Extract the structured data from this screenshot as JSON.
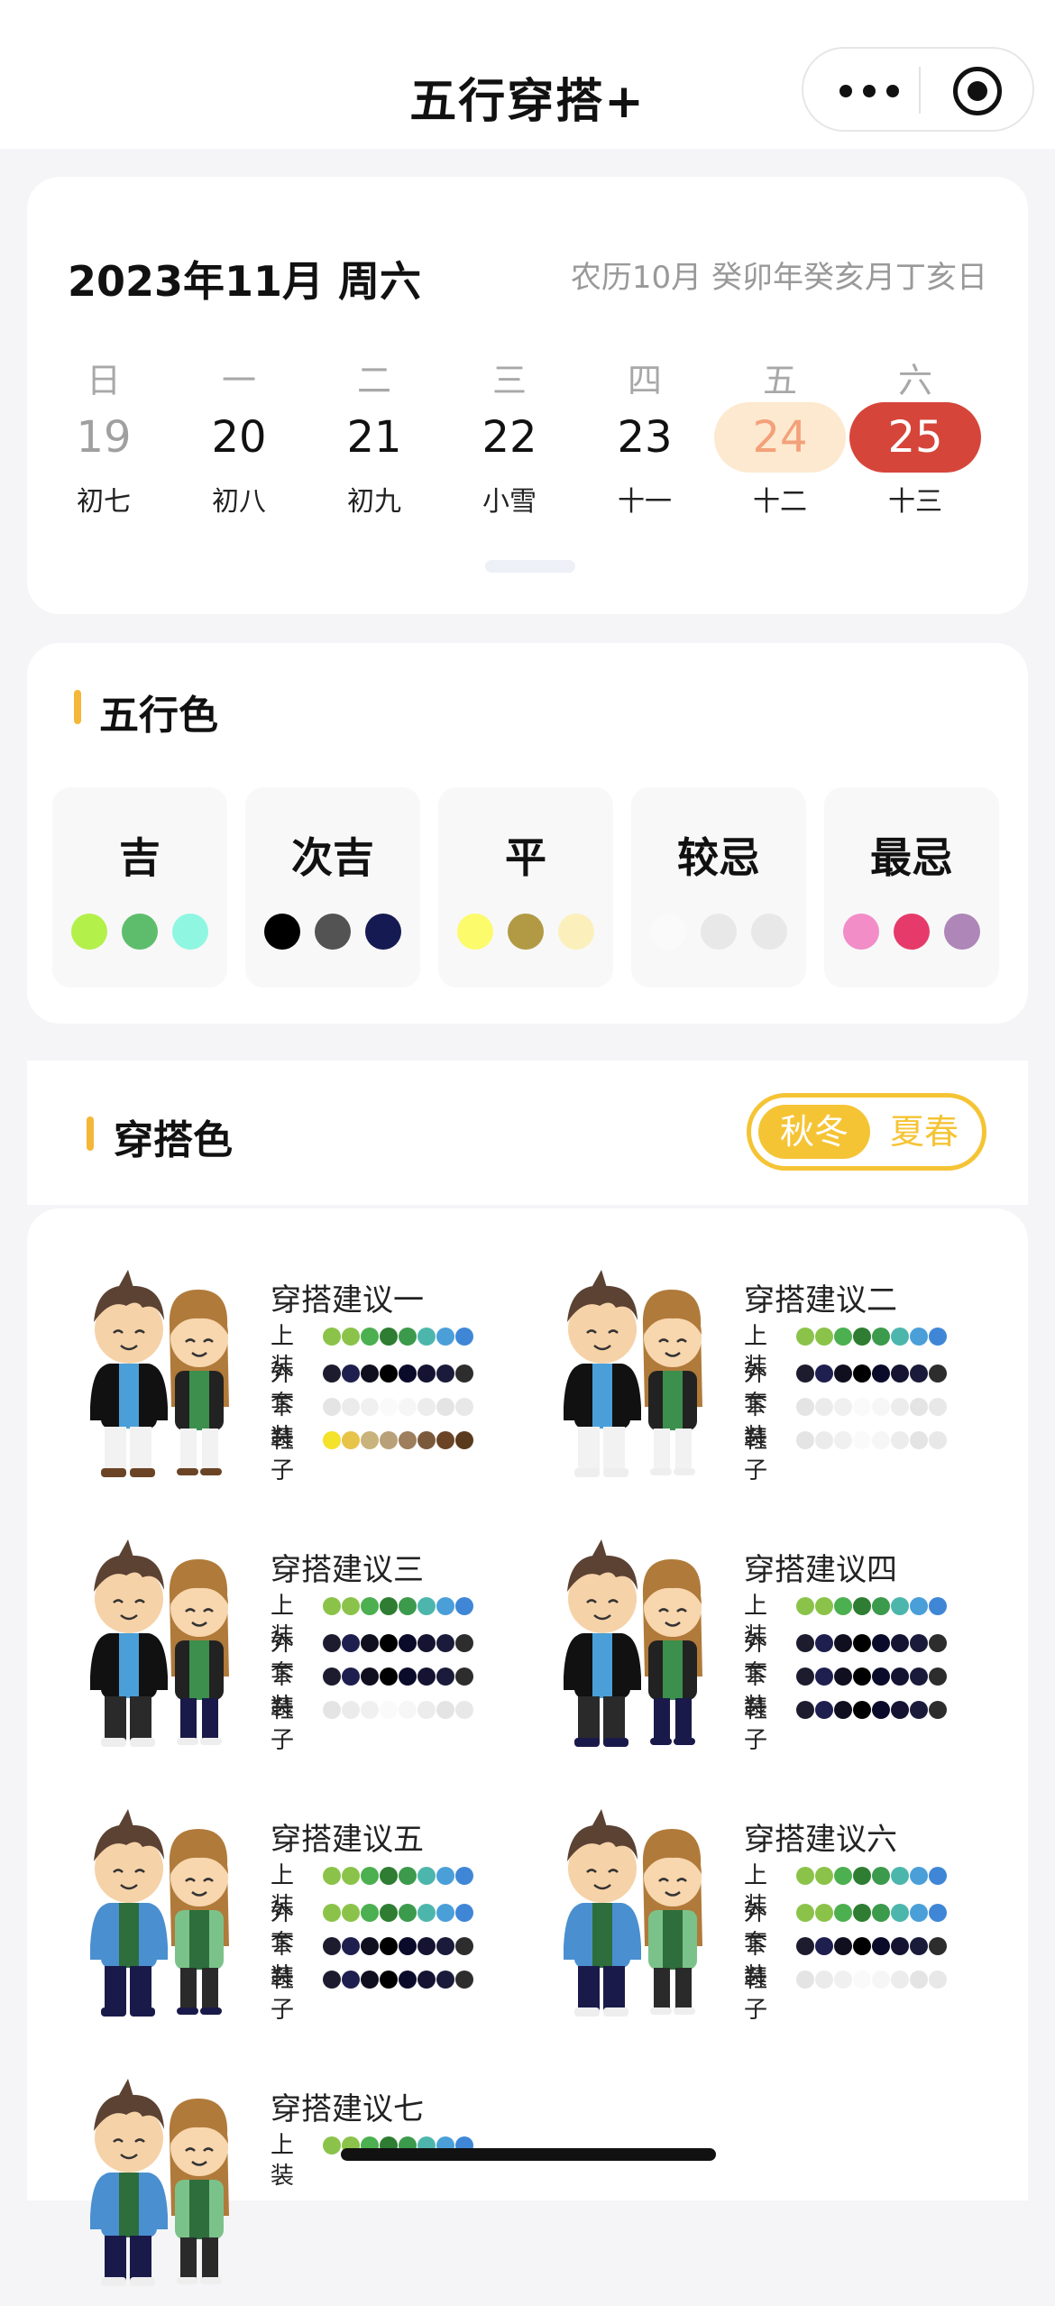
{
  "nav": {
    "title": "五行穿搭+"
  },
  "calendar": {
    "date_title": "2023年11月 周六",
    "lunar_info": "农历10月 癸卯年癸亥月丁亥日",
    "days": [
      {
        "weekday": "日",
        "date": "19",
        "lunar": "初七",
        "state": "past"
      },
      {
        "weekday": "一",
        "date": "20",
        "lunar": "初八",
        "state": "normal"
      },
      {
        "weekday": "二",
        "date": "21",
        "lunar": "初九",
        "state": "normal"
      },
      {
        "weekday": "三",
        "date": "22",
        "lunar": "小雪",
        "state": "normal"
      },
      {
        "weekday": "四",
        "date": "23",
        "lunar": "十一",
        "state": "normal"
      },
      {
        "weekday": "五",
        "date": "24",
        "lunar": "十二",
        "state": "highlight"
      },
      {
        "weekday": "六",
        "date": "25",
        "lunar": "十三",
        "state": "selected"
      }
    ]
  },
  "five_colors": {
    "title": "五行色",
    "groups": [
      {
        "label": "吉",
        "colors": [
          "#b3f04a",
          "#5dbd6c",
          "#8ff7e1"
        ]
      },
      {
        "label": "次吉",
        "colors": [
          "#000000",
          "#535353",
          "#161a52"
        ]
      },
      {
        "label": "平",
        "colors": [
          "#fbfb6c",
          "#b19a43",
          "#fbf0bb"
        ]
      },
      {
        "label": "较忌",
        "colors": [
          "#fafafa",
          "#e8e8e8",
          "#e8e8e8"
        ]
      },
      {
        "label": "最忌",
        "colors": [
          "#f28dc8",
          "#e63a6a",
          "#ae86b8"
        ]
      }
    ]
  },
  "outfit_section": {
    "title": "穿搭色",
    "toggle": {
      "active": "秋冬",
      "inactive": "夏春"
    },
    "palettes": {
      "green": [
        "#8bc34a",
        "#8bc34a",
        "#4caf50",
        "#2e7d32",
        "#3c9a4c",
        "#4db6ac",
        "#4a9fd8",
        "#3f87d6"
      ],
      "dark": [
        "#1c1c2e",
        "#1e1e4f",
        "#0f0f1f",
        "#000000",
        "#0a0a2a",
        "#141432",
        "#1a1a3a",
        "#2d2d2d"
      ],
      "light": [
        "#e4e4e4",
        "#ebebeb",
        "#f0f0f0",
        "#fafafa",
        "#f6f6f6",
        "#ececec",
        "#e4e4e4",
        "#e8e8e8"
      ],
      "shoes": [
        "#f4e22b",
        "#e8c34a",
        "#c9b37c",
        "#b8a178",
        "#9e7e5c",
        "#7b5a3c",
        "#6b4426",
        "#5a3a1c"
      ]
    },
    "row_labels": [
      "上装",
      "外套",
      "下装",
      "鞋子"
    ],
    "outfits": [
      {
        "title": "穿搭建议一",
        "rows": [
          "green",
          "dark",
          "light",
          "shoes"
        ],
        "look": {
          "top": "#4a9fd8",
          "jacket": "#111111",
          "pants": "#f2f2f2",
          "shoes": "#6b4426",
          "w_top": "#3c8f4c",
          "w_jacket": "#222222",
          "w_pants": "#f2f2f2",
          "w_shoes": "#6b4426"
        }
      },
      {
        "title": "穿搭建议二",
        "rows": [
          "green",
          "dark",
          "light",
          "light"
        ],
        "look": {
          "top": "#4a9fd8",
          "jacket": "#111111",
          "pants": "#f2f2f2",
          "shoes": "#eeeeee",
          "w_top": "#3c8f4c",
          "w_jacket": "#222222",
          "w_pants": "#f2f2f2",
          "w_shoes": "#eeeeee"
        }
      },
      {
        "title": "穿搭建议三",
        "rows": [
          "green",
          "dark",
          "dark",
          "light"
        ],
        "look": {
          "top": "#4a9fd8",
          "jacket": "#111111",
          "pants": "#2a2a2a",
          "shoes": "#eeeeee",
          "w_top": "#3c8f4c",
          "w_jacket": "#222222",
          "w_pants": "#1a1a4a",
          "w_shoes": "#eeeeee"
        }
      },
      {
        "title": "穿搭建议四",
        "rows": [
          "green",
          "dark",
          "dark",
          "dark"
        ],
        "look": {
          "top": "#4a9fd8",
          "jacket": "#111111",
          "pants": "#2a2a2a",
          "shoes": "#1a1a4a",
          "w_top": "#3c8f4c",
          "w_jacket": "#222222",
          "w_pants": "#1a1a4a",
          "w_shoes": "#1a1a4a"
        }
      },
      {
        "title": "穿搭建议五",
        "rows": [
          "green",
          "green",
          "dark",
          "dark"
        ],
        "look": {
          "top": "#2d6e3c",
          "jacket": "#4a8fd0",
          "pants": "#1a1a4a",
          "shoes": "#1a1a4a",
          "w_top": "#2d6e3c",
          "w_jacket": "#7bc28a",
          "w_pants": "#2a2a2a",
          "w_shoes": "#1a1a4a"
        }
      },
      {
        "title": "穿搭建议六",
        "rows": [
          "green",
          "green",
          "dark",
          "light"
        ],
        "look": {
          "top": "#2d6e3c",
          "jacket": "#4a8fd0",
          "pants": "#1a1a4a",
          "shoes": "#eeeeee",
          "w_top": "#2d6e3c",
          "w_jacket": "#7bc28a",
          "w_pants": "#2a2a2a",
          "w_shoes": "#eeeeee"
        }
      },
      {
        "title": "穿搭建议七",
        "rows": [
          "green"
        ],
        "look": {
          "top": "#2d6e3c",
          "jacket": "#4a8fd0",
          "pants": "#1a1a4a",
          "shoes": "#eeeeee",
          "w_top": "#2d6e3c",
          "w_jacket": "#7bc28a",
          "w_pants": "#2a2a2a",
          "w_shoes": "#eeeeee"
        }
      }
    ]
  }
}
